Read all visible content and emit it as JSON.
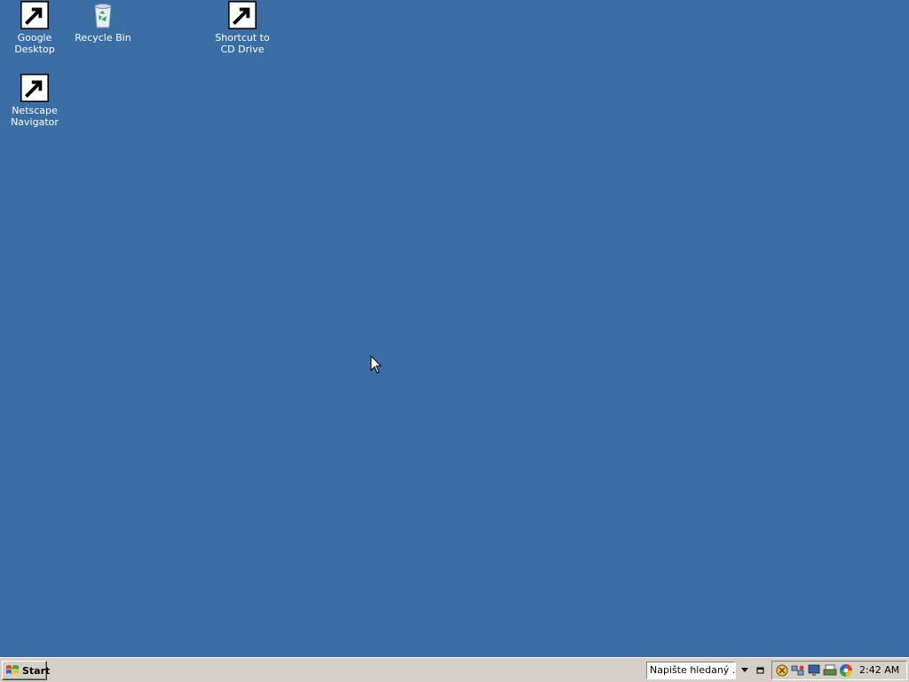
{
  "desktop": {
    "background_color": "#3a6ea5",
    "icons": [
      {
        "label": "Google Desktop",
        "icon": "google-desktop-icon",
        "shortcut": true
      },
      {
        "label": "Recycle Bin",
        "icon": "recycle-bin-icon",
        "shortcut": false
      },
      {
        "label": "Shortcut to CD Drive",
        "icon": "cd-drive-icon",
        "shortcut": true
      },
      {
        "label": "Netscape Navigator",
        "icon": "netscape-icon",
        "shortcut": true
      }
    ]
  },
  "taskbar": {
    "start_label": "Start",
    "search": {
      "placeholder": "Napište hledaný ..."
    },
    "tray_icons": [
      "security-icon",
      "network-icon",
      "monitor-icon",
      "printer-icon",
      "google-icon"
    ],
    "clock": "2:42 AM"
  }
}
